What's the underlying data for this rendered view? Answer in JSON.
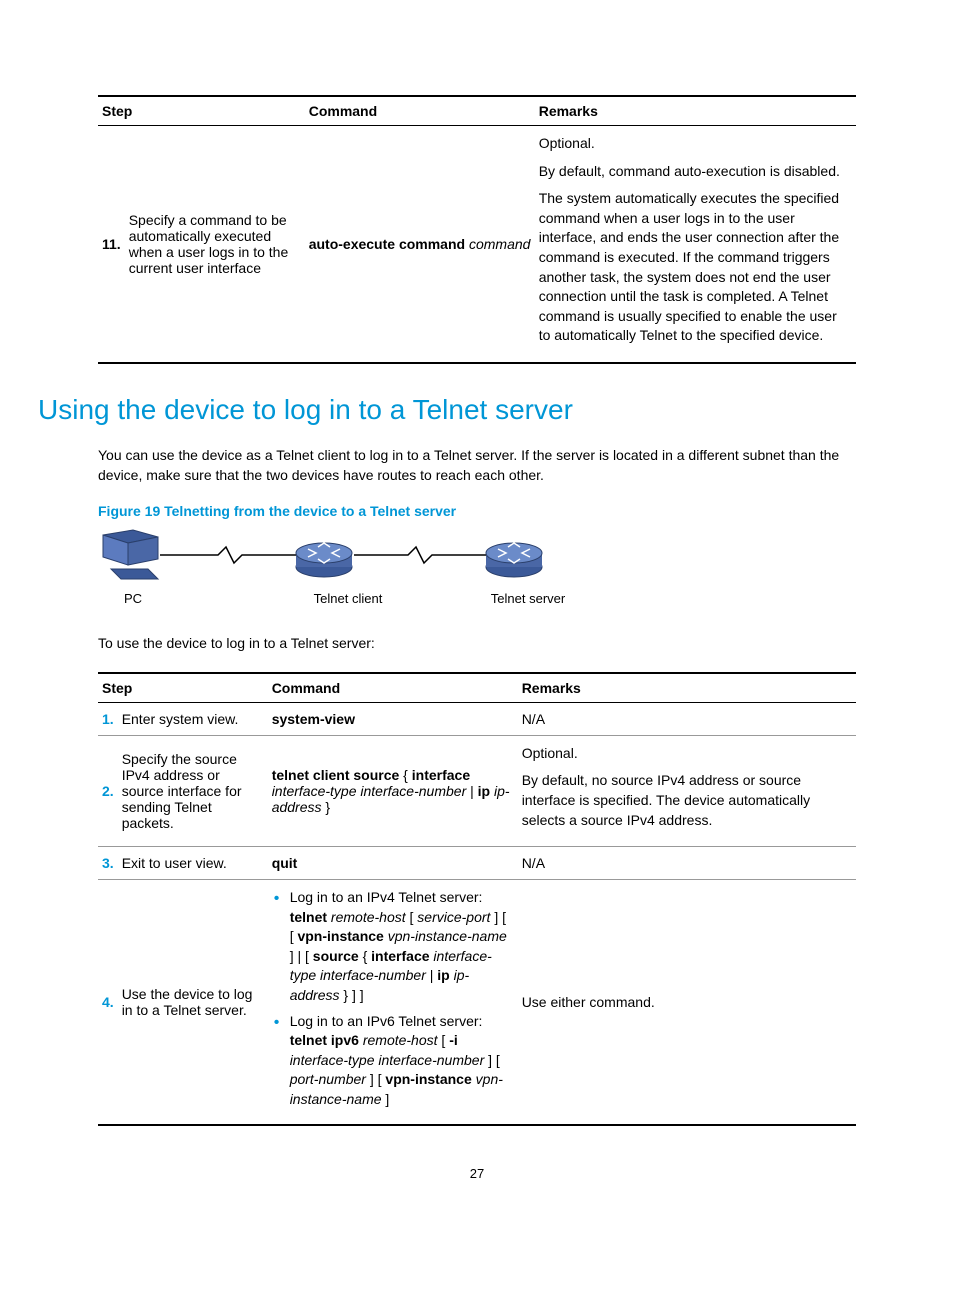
{
  "table1": {
    "headers": {
      "step": "Step",
      "command": "Command",
      "remarks": "Remarks"
    },
    "row": {
      "num": "11.",
      "desc": "Specify a command to be automatically executed when a user logs in to the current user interface",
      "cmd_bold": "auto-execute command",
      "cmd_ital": "command",
      "remarks_p1": "Optional.",
      "remarks_p2": "By default, command auto-execution is disabled.",
      "remarks_p3": "The system automatically executes the specified command when a user logs in to the user interface, and ends the user connection after the command is executed. If the command triggers another task, the system does not end the user connection until the task is completed. A Telnet command is usually specified to enable the user to automatically Telnet to the specified device."
    }
  },
  "section_title": "Using the device to log in to a Telnet server",
  "intro_text": "You can use the device as a Telnet client to log in to a Telnet server. If the server is located in a different subnet than the device, make sure that the two devices have routes to reach each other.",
  "fig_caption": "Figure 19 Telnetting from the device to a Telnet server",
  "fig_labels": {
    "pc": "PC",
    "client": "Telnet client",
    "server": "Telnet server"
  },
  "lead_in": "To use the device to log in to a Telnet server:",
  "table2": {
    "headers": {
      "step": "Step",
      "command": "Command",
      "remarks": "Remarks"
    },
    "rows": {
      "r1": {
        "num": "1.",
        "desc": "Enter system view.",
        "cmd": "system-view",
        "remarks": "N/A"
      },
      "r2": {
        "num": "2.",
        "desc": "Specify the source IPv4 address or source interface for sending Telnet packets.",
        "cmd_b1": "telnet client source",
        "cmd_t1": " { ",
        "cmd_b2": "interface",
        "cmd_i1": "interface-type interface-number",
        "cmd_t2": " | ",
        "cmd_b3": "ip",
        "cmd_i2": "ip-address",
        "cmd_t3": " }",
        "remarks_p1": "Optional.",
        "remarks_p2": "By default, no source IPv4 address or source interface is specified. The device automatically selects a source IPv4 address."
      },
      "r3": {
        "num": "3.",
        "desc": "Exit to user view.",
        "cmd": "quit",
        "remarks": "N/A"
      },
      "r4": {
        "num": "4.",
        "desc": "Use the device to log in to a Telnet server.",
        "li1_lead": "Log in to an IPv4 Telnet server:",
        "li1_b1": "telnet",
        "li1_i1": " remote-host",
        "li1_t1": " [ ",
        "li1_i2": "service-port",
        "li1_t2": " ] [ [ ",
        "li1_b2": "vpn-instance",
        "li1_i3": " vpn-instance-name",
        "li1_t3": " ] | [ ",
        "li1_b3": "source",
        "li1_t4": " { ",
        "li1_b4": "interface",
        "li1_i4": " interface-type interface-number",
        "li1_t5": " | ",
        "li1_b5": "ip",
        "li1_i5": " ip-address",
        "li1_t6": " } ] ]",
        "li2_lead": "Log in to an IPv6 Telnet server:",
        "li2_b1": "telnet ipv6",
        "li2_i1": " remote-host",
        "li2_t1": " [ ",
        "li2_b2": "-i",
        "li2_i2": " interface-type interface-number",
        "li2_t2": " ] [ ",
        "li2_i3": "port-number",
        "li2_t3": " ] [ ",
        "li2_b3": "vpn-instance",
        "li2_i4": " vpn-instance-name",
        "li2_t4": " ]",
        "remarks": "Use either command."
      }
    }
  },
  "page_number": "27"
}
